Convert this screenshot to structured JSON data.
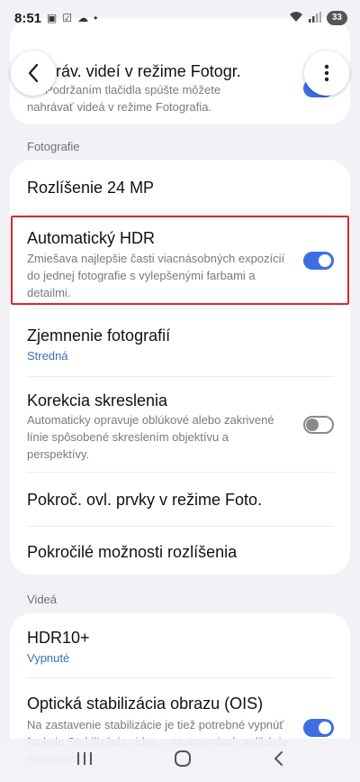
{
  "status_bar": {
    "time": "8:51",
    "battery": "33"
  },
  "top_card": {
    "title": "ráv. videí v režime Fotogr.",
    "desc_line1": "Podržaním tlačidla spúšte môžete",
    "desc_line2": "nahrávať videá v režime Fotografia."
  },
  "sections": {
    "photos": "Fotografie",
    "videos": "Videá"
  },
  "photo_items": {
    "resolution": "Rozlíšenie 24 MP",
    "hdr_title": "Automatický HDR",
    "hdr_desc": "Zmiešava najlepšie časti viacnásobných expozícií do jednej fotografie s vylepšenými farbami a detailmi.",
    "hdr_state": true,
    "soften_title": "Zjemnenie fotografií",
    "soften_value": "Stredná",
    "distortion_title": "Korekcia skreslenia",
    "distortion_desc": "Automaticky opravuje oblúkové alebo zakrivené línie spôsobené skreslením objektívu a perspektívy.",
    "distortion_state": false,
    "advanced_controls": "Pokroč. ovl. prvky v režime Foto.",
    "advanced_resolution": "Pokročilé možnosti rozlíšenia"
  },
  "video_items": {
    "hdr10_title": "HDR10+",
    "hdr10_value": "Vypnuté",
    "ois_title": "Optická stabilizácia obrazu (OIS)",
    "ois_desc": "Na zastavenie stabilizácie je tiež potrebné vypnúť funkciu Stabilizácia videa v nastaveniach aplikácie Fotoaparát.",
    "ois_state": true
  },
  "colors": {
    "accent": "#3d6fe3",
    "link": "#3a6fb5",
    "highlight": "#e0262a"
  }
}
